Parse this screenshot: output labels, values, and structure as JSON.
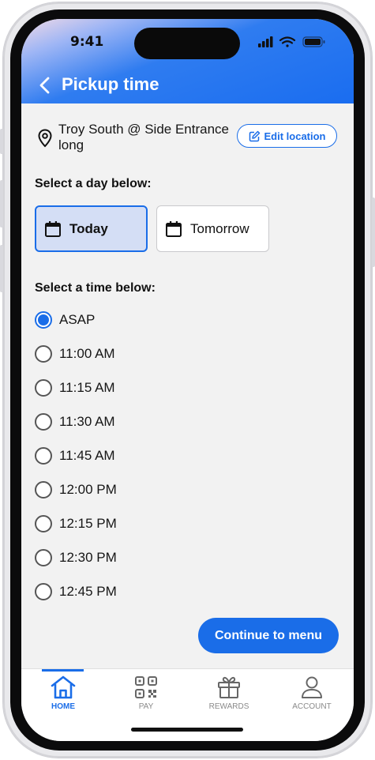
{
  "status": {
    "time": "9:41"
  },
  "header": {
    "title": "Pickup time"
  },
  "location": {
    "name": "Troy South @ Side Entrance long",
    "edit_label": "Edit location"
  },
  "day_section": {
    "label": "Select a day below:",
    "days": [
      {
        "label": "Today",
        "selected": true
      },
      {
        "label": "Tomorrow",
        "selected": false
      }
    ]
  },
  "time_section": {
    "label": "Select a time below:",
    "times": [
      {
        "label": "ASAP",
        "selected": true
      },
      {
        "label": "11:00 AM",
        "selected": false
      },
      {
        "label": "11:15 AM",
        "selected": false
      },
      {
        "label": "11:30 AM",
        "selected": false
      },
      {
        "label": "11:45 AM",
        "selected": false
      },
      {
        "label": "12:00 PM",
        "selected": false
      },
      {
        "label": "12:15 PM",
        "selected": false
      },
      {
        "label": "12:30 PM",
        "selected": false
      },
      {
        "label": "12:45 PM",
        "selected": false
      }
    ]
  },
  "continue_label": "Continue to menu",
  "tabs": [
    {
      "label": "HOME",
      "icon": "home-icon",
      "active": true
    },
    {
      "label": "PAY",
      "icon": "qr-code-icon",
      "active": false
    },
    {
      "label": "REWARDS",
      "icon": "gift-icon",
      "active": false
    },
    {
      "label": "ACCOUNT",
      "icon": "user-icon",
      "active": false
    }
  ],
  "colors": {
    "accent": "#1a6de8",
    "background": "#f2f2f2",
    "selected_day_bg": "#d4def5"
  }
}
